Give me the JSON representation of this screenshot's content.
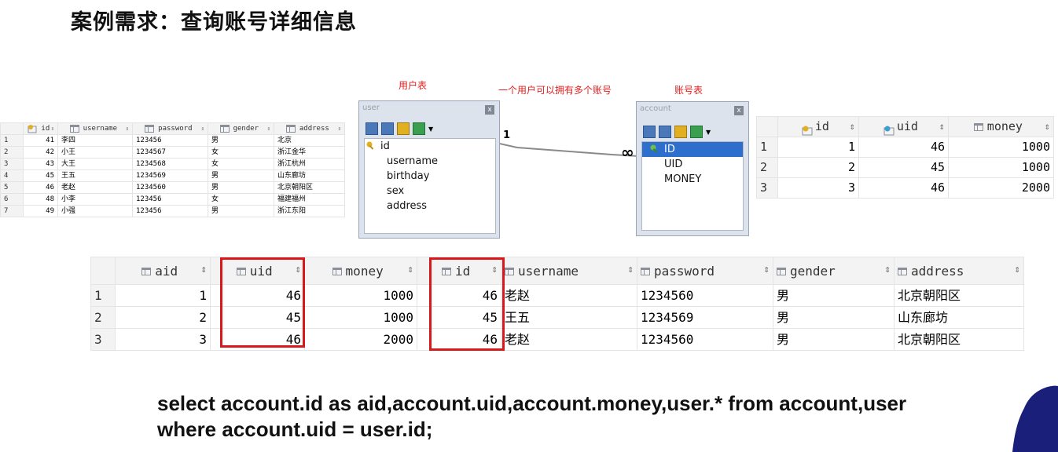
{
  "title": "案例需求：查询账号详细信息",
  "user_table": {
    "headers": [
      "id",
      "username",
      "password",
      "gender",
      "address"
    ],
    "rows": [
      [
        "1",
        "41",
        "李四",
        "123456",
        "男",
        "北京"
      ],
      [
        "2",
        "42",
        "小王",
        "1234567",
        "女",
        "浙江金华"
      ],
      [
        "3",
        "43",
        "大王",
        "1234568",
        "女",
        "浙江杭州"
      ],
      [
        "4",
        "45",
        "王五",
        "1234569",
        "男",
        "山东廊坊"
      ],
      [
        "5",
        "46",
        "老赵",
        "1234560",
        "男",
        "北京朝阳区"
      ],
      [
        "6",
        "48",
        "小李",
        "123456",
        "女",
        "福建福州"
      ],
      [
        "7",
        "49",
        "小强",
        "123456",
        "男",
        "浙江东阳"
      ]
    ]
  },
  "diagram": {
    "user_caption": "用户表",
    "relation_caption": "一个用户可以拥有多个账号",
    "account_caption": "账号表",
    "user_entity": {
      "name": "user",
      "close": "x",
      "fields": [
        "id",
        "username",
        "birthday",
        "sex",
        "address"
      ]
    },
    "account_entity": {
      "name": "account",
      "close": "x",
      "fields": [
        "ID",
        "UID",
        "MONEY"
      ]
    },
    "one_label": "1",
    "many_label": "∞"
  },
  "account_table": {
    "headers": [
      "id",
      "uid",
      "money"
    ],
    "rows": [
      [
        "1",
        "1",
        "46",
        "1000"
      ],
      [
        "2",
        "2",
        "45",
        "1000"
      ],
      [
        "3",
        "3",
        "46",
        "2000"
      ]
    ]
  },
  "result_table": {
    "headers": [
      "aid",
      "uid",
      "money",
      "id",
      "username",
      "password",
      "gender",
      "address"
    ],
    "rows": [
      [
        "1",
        "1",
        "46",
        "1000",
        "46",
        "老赵",
        "1234560",
        "男",
        "北京朝阳区"
      ],
      [
        "2",
        "2",
        "45",
        "1000",
        "45",
        "王五",
        "1234569",
        "男",
        "山东廊坊"
      ],
      [
        "3",
        "3",
        "46",
        "2000",
        "46",
        "老赵",
        "1234560",
        "男",
        "北京朝阳区"
      ]
    ]
  },
  "sql": {
    "line1": "select account.id as aid,account.uid,account.money,user.* from account,user",
    "line2": "where account.uid = user.id;"
  },
  "colors": {
    "highlight": "#d7191c",
    "caption": "#e02020",
    "selected": "#2e6fce"
  }
}
